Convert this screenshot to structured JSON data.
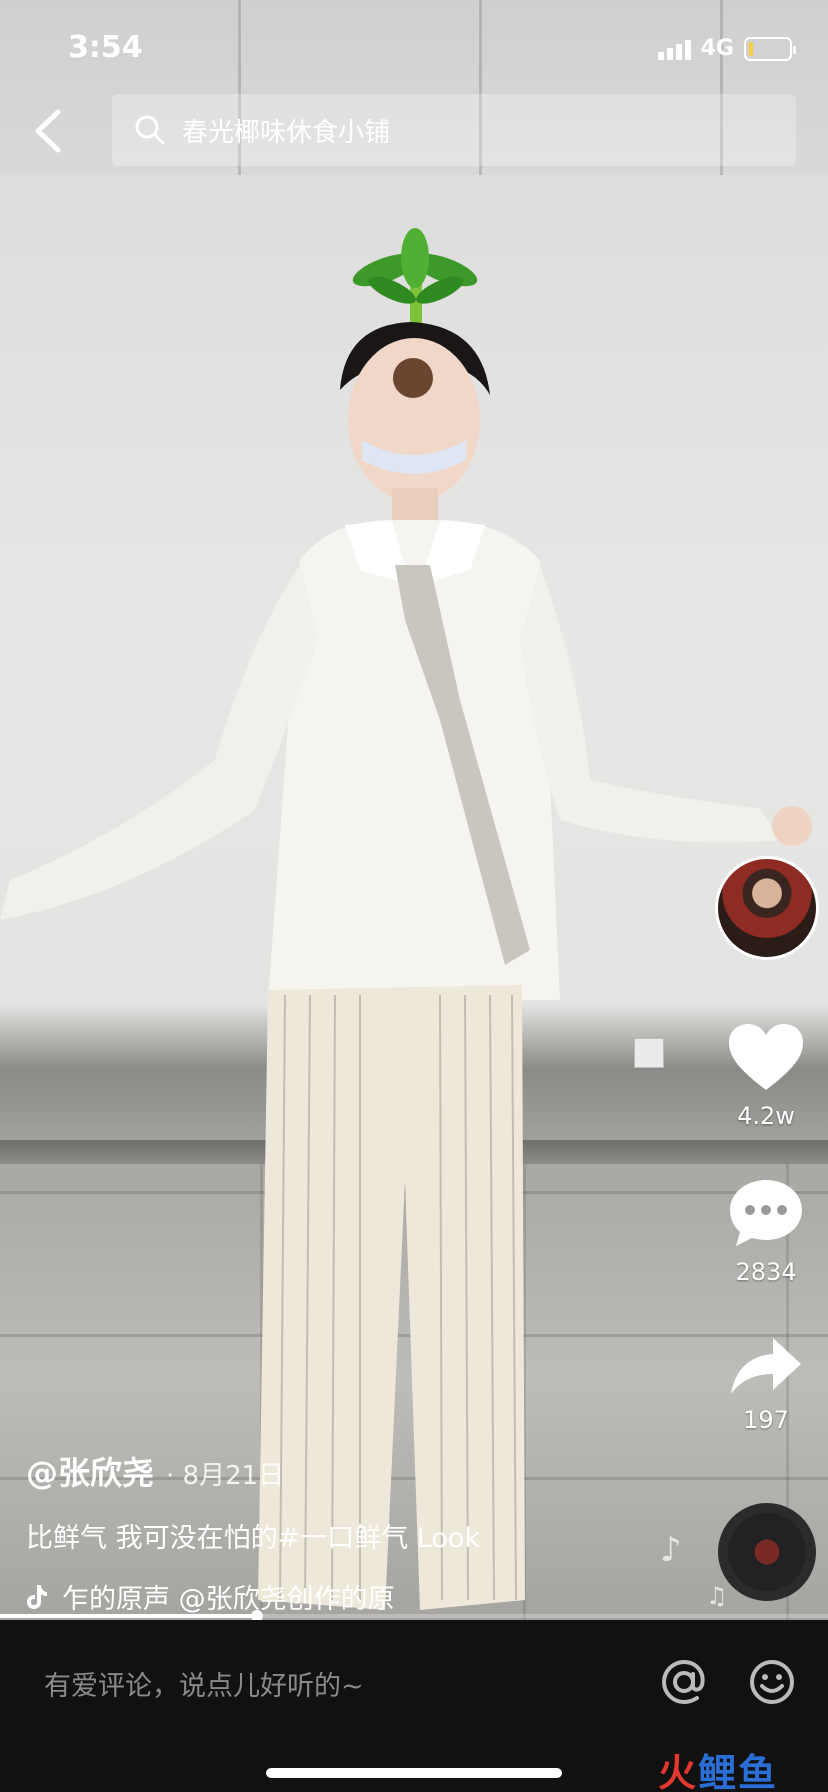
{
  "status_bar": {
    "time": "3:54",
    "network": "4G",
    "battery_level": 0.1
  },
  "search": {
    "query": "春光椰味休食小铺"
  },
  "video": {
    "progress": 0.31
  },
  "rail": {
    "likes": "4.2w",
    "comments": "2834",
    "shares": "197"
  },
  "caption": {
    "author": "@张欣尧",
    "date": "· 8月21日",
    "description": "比鲜气 我可没在怕的#一口鲜气 Look",
    "music": "乍的原声    @张欣尧创作的原"
  },
  "comment_bar": {
    "placeholder": "有爱评论，说点儿好听的~"
  },
  "watermark": {
    "part1": "火",
    "part2": "鲤鱼"
  },
  "icons": [
    "back-chevron-icon",
    "search-icon",
    "heart-icon",
    "comment-icon",
    "share-icon",
    "tiktok-note-icon",
    "music-note-icon",
    "at-icon",
    "emoji-icon"
  ],
  "colors": {
    "battery": "#f4d13a",
    "watermark_red": "#e0382f",
    "watermark_blue": "#2b6fd6"
  }
}
